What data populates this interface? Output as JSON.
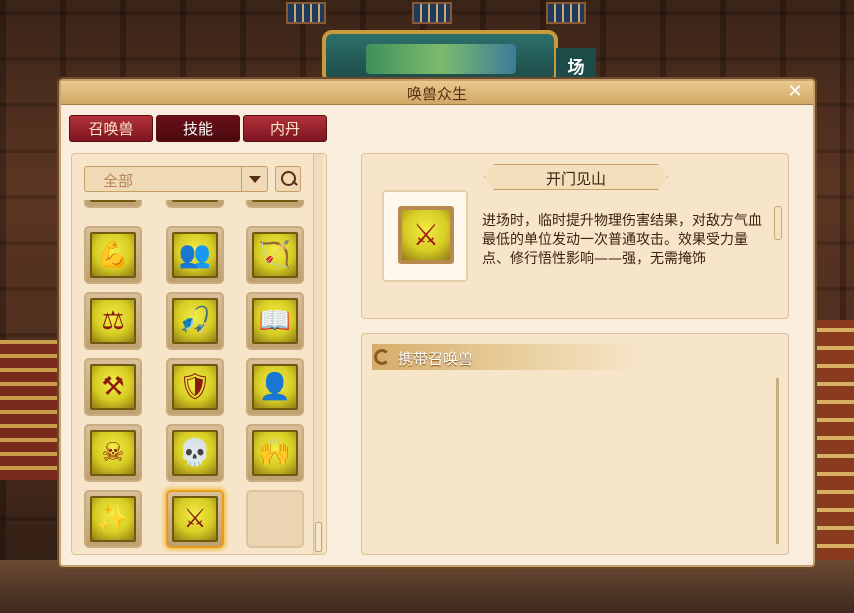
{
  "window": {
    "title": "唤兽众生",
    "close_label": "✕"
  },
  "background": {
    "sign_char": "场"
  },
  "tabs": [
    {
      "label": "召唤兽",
      "active": false
    },
    {
      "label": "技能",
      "active": true
    },
    {
      "label": "内丹",
      "active": false
    }
  ],
  "filter": {
    "selected": "全部"
  },
  "skills_grid": [
    {
      "icon": "strength-icon",
      "glyph": "💪"
    },
    {
      "icon": "summon-child-icon",
      "glyph": "👥"
    },
    {
      "icon": "bow-icon",
      "glyph": "🏹"
    },
    {
      "icon": "coin-bow-icon",
      "glyph": "⚖"
    },
    {
      "icon": "fisherman-icon",
      "glyph": "🎣"
    },
    {
      "icon": "spellbook-icon",
      "glyph": "📖"
    },
    {
      "icon": "crossed-tools-icon",
      "glyph": "⚒"
    },
    {
      "icon": "warrior-icon",
      "glyph": "🛡"
    },
    {
      "icon": "hooded-figure-icon",
      "glyph": "👤"
    },
    {
      "icon": "moon-skull-icon",
      "glyph": "☠"
    },
    {
      "icon": "skull-club-icon",
      "glyph": "💀"
    },
    {
      "icon": "cheer-figure-icon",
      "glyph": "🙌"
    },
    {
      "icon": "sparkle-altar-icon",
      "glyph": "✨"
    },
    {
      "icon": "slash-sword-icon",
      "glyph": "⚔",
      "selected": true
    },
    {
      "icon": "empty-slot",
      "glyph": "",
      "empty": true
    }
  ],
  "detail": {
    "skill_name": "开门见山",
    "skill_icon": "slash-sword-icon",
    "skill_glyph": "⚔",
    "description": "进场时，临时提升物理伤害结果，对敌方气血最低的单位发动一次普通攻击。效果受力量点、修行悟性影响——强，无需掩饰"
  },
  "pets": {
    "header": "携带召唤兽"
  },
  "colors": {
    "tab_red": "#7c1420",
    "icon_yellow": "#d6cc24",
    "panel_bg": "#f7e5c9",
    "selection_orange": "#e89b16"
  }
}
